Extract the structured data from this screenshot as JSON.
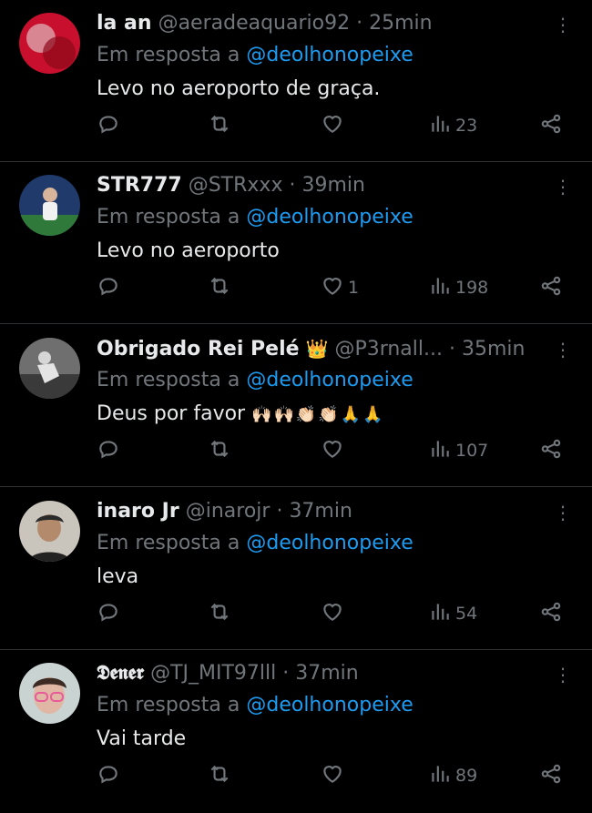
{
  "in_reply_prefix": "Em resposta a",
  "replies": [
    {
      "name": "la an",
      "handle": "@aeradeaquario92",
      "time": "25min",
      "mention": "@deolhonopeixe",
      "text": "Levo no aeroporto de graça.",
      "likes": "",
      "views": "23",
      "avatar_color": "#c8102e"
    },
    {
      "name": "STR777",
      "handle": "@STRxxx",
      "time": "39min",
      "mention": "@deolhonopeixe",
      "text": "Levo no aeroporto",
      "likes": "1",
      "views": "198",
      "avatar_color": "#2a4f8a"
    },
    {
      "name": "Obrigado Rei Pelé",
      "name_badge": "👑",
      "handle": "@P3rnall...",
      "time": "35min",
      "mention": "@deolhonopeixe",
      "text": "Deus por favor",
      "text_emoji": "🙌🏻🙌🏻👏🏻👏🏻🙏🙏",
      "likes": "",
      "views": "107",
      "avatar_color": "#9a9a9a"
    },
    {
      "name": "inaro Jr",
      "handle": "@inarojr",
      "time": "37min",
      "mention": "@deolhonopeixe",
      "text": "leva",
      "likes": "",
      "views": "54",
      "avatar_color": "#b7b2ab"
    },
    {
      "name": "𝕯𝖊𝖓𝖊𝖗",
      "handle": "@TJ_MIT97lll",
      "time": "37min",
      "mention": "@deolhonopeixe",
      "text": "Vai tarde",
      "likes": "",
      "views": "89",
      "avatar_color": "#c9d3d2"
    }
  ],
  "icons": {
    "more": "more-vertical-icon",
    "reply": "reply-bubble-icon",
    "repost": "repost-icon",
    "like": "heart-icon",
    "views": "views-bar-chart-icon",
    "share": "share-icon"
  }
}
